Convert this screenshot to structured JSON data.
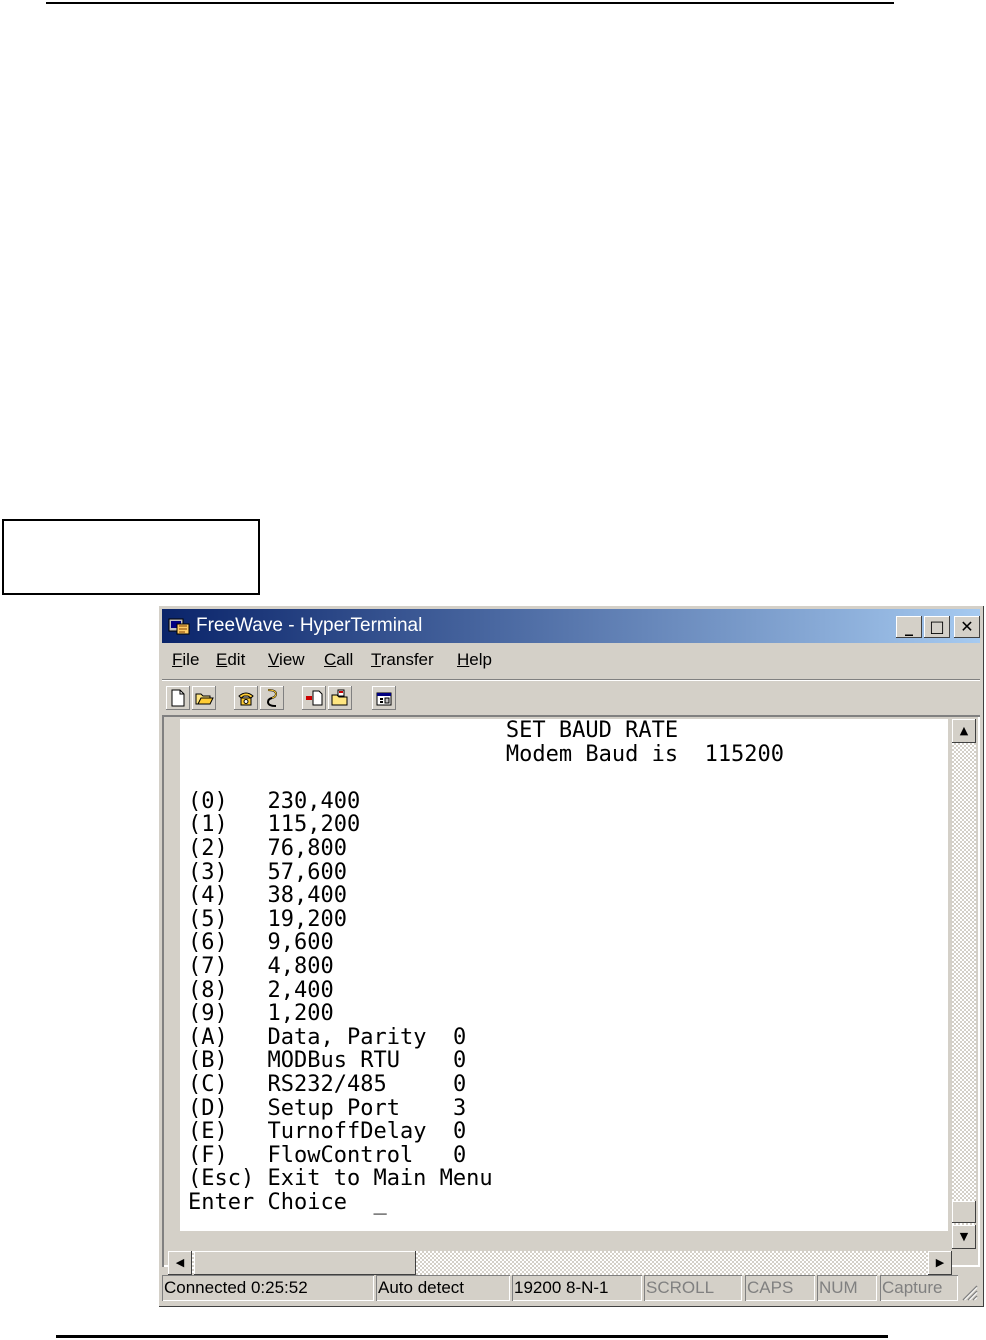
{
  "window": {
    "title": "FreeWave - HyperTerminal",
    "minimize_label": "_",
    "maximize_label": "□",
    "close_label": "✕"
  },
  "menu": [
    {
      "label": "File",
      "mnemonic": "F",
      "rest": "ile"
    },
    {
      "label": "Edit",
      "mnemonic": "E",
      "rest": "dit"
    },
    {
      "label": "View",
      "mnemonic": "V",
      "rest": "iew"
    },
    {
      "label": "Call",
      "mnemonic": "C",
      "rest": "all"
    },
    {
      "label": "Transfer",
      "mnemonic": "T",
      "rest": "ransfer"
    },
    {
      "label": "Help",
      "mnemonic": "H",
      "rest": "elp"
    }
  ],
  "toolbar": {
    "icons": [
      "new-document-icon",
      "open-folder-icon",
      "call-phone-icon",
      "disconnect-phone-icon",
      "send-file-icon",
      "receive-file-icon",
      "properties-icon"
    ]
  },
  "terminal": {
    "header_line1": "SET BAUD RATE",
    "header_line2": "Modem Baud is  115200",
    "options": [
      {
        "key": "(0)",
        "label": "230,400",
        "value": ""
      },
      {
        "key": "(1)",
        "label": "115,200",
        "value": ""
      },
      {
        "key": "(2)",
        "label": "76,800",
        "value": ""
      },
      {
        "key": "(3)",
        "label": "57,600",
        "value": ""
      },
      {
        "key": "(4)",
        "label": "38,400",
        "value": ""
      },
      {
        "key": "(5)",
        "label": "19,200",
        "value": ""
      },
      {
        "key": "(6)",
        "label": "9,600",
        "value": ""
      },
      {
        "key": "(7)",
        "label": "4,800",
        "value": ""
      },
      {
        "key": "(8)",
        "label": "2,400",
        "value": ""
      },
      {
        "key": "(9)",
        "label": "1,200",
        "value": ""
      },
      {
        "key": "(A)",
        "label": "Data, Parity",
        "value": "0"
      },
      {
        "key": "(B)",
        "label": "MODBus RTU",
        "value": "0"
      },
      {
        "key": "(C)",
        "label": "RS232/485",
        "value": "0"
      },
      {
        "key": "(D)",
        "label": "Setup Port",
        "value": "3"
      },
      {
        "key": "(E)",
        "label": "TurnoffDelay",
        "value": "0"
      },
      {
        "key": "(F)",
        "label": "FlowControl",
        "value": "0"
      },
      {
        "key": "(Esc)",
        "label": "Exit to Main Menu",
        "value": ""
      }
    ],
    "prompt": "Enter Choice",
    "cursor": "_"
  },
  "status": {
    "connection": "Connected 0:25:52",
    "emulation": "Auto detect",
    "port_settings": "19200 8-N-1",
    "scroll": "SCROLL",
    "caps": "CAPS",
    "num": "NUM",
    "capture": "Capture"
  }
}
